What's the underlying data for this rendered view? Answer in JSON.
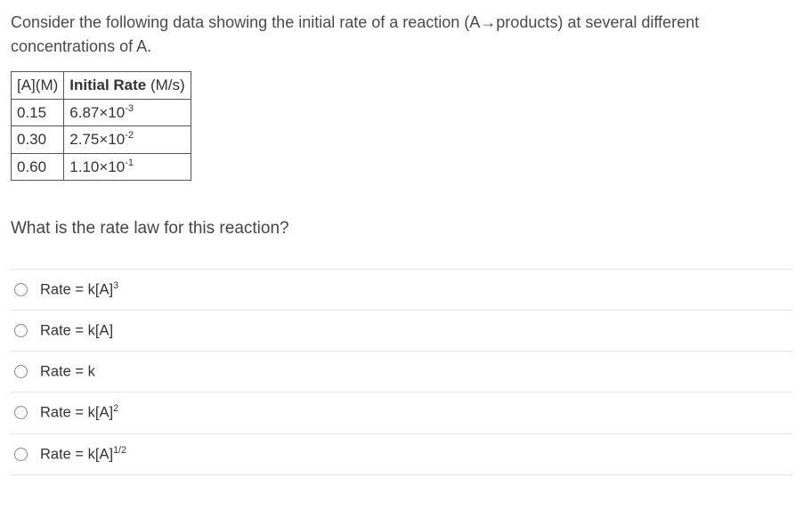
{
  "intro": "Consider the following data showing the initial rate of a reaction (A→products) at several different concentrations of A.",
  "table": {
    "headers": {
      "col1": "[A](M)",
      "col2_pre": "Initial Rate",
      "col2_suf": " (M/s)"
    },
    "rows": [
      {
        "conc": "0.15",
        "rate_base": "6.87×10",
        "rate_exp": "-3"
      },
      {
        "conc": "0.30",
        "rate_base": "2.75×10",
        "rate_exp": "-2"
      },
      {
        "conc": "0.60",
        "rate_base": "1.10×10",
        "rate_exp": "-1"
      }
    ]
  },
  "question": "What is the rate law for this reaction?",
  "options": [
    {
      "pre": "Rate = k[A]",
      "sup": "3",
      "post": ""
    },
    {
      "pre": "Rate = k[A]",
      "sup": "",
      "post": ""
    },
    {
      "pre": "Rate = k",
      "sup": "",
      "post": ""
    },
    {
      "pre": "Rate = k[A]",
      "sup": "2",
      "post": ""
    },
    {
      "pre": "Rate = k[A]",
      "sup": "1/2",
      "post": ""
    }
  ],
  "chart_data": {
    "type": "table",
    "title": "Initial rate vs concentration of A",
    "columns": [
      "[A] (M)",
      "Initial Rate (M/s)"
    ],
    "rows": [
      [
        0.15,
        0.00687
      ],
      [
        0.3,
        0.0275
      ],
      [
        0.6,
        0.11
      ]
    ]
  }
}
